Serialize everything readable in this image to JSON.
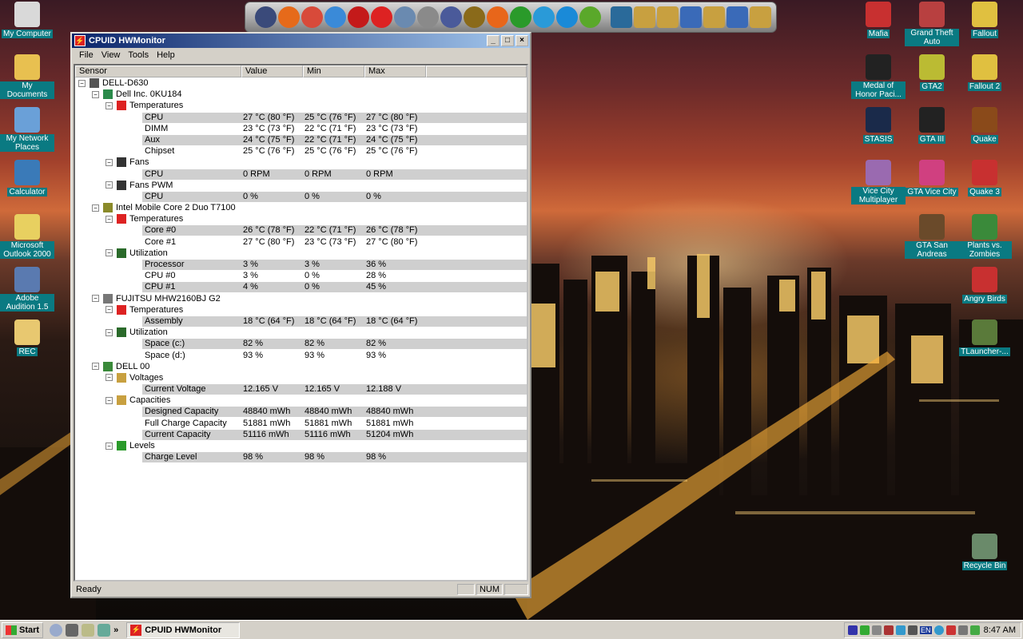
{
  "desktop": {
    "left_icons": [
      {
        "label": "My Computer",
        "icon": "my-computer-icon"
      },
      {
        "label": "My Documents",
        "icon": "my-documents-icon"
      },
      {
        "label": "My Network Places",
        "icon": "network-places-icon"
      },
      {
        "label": "Calculator",
        "icon": "calculator-icon"
      },
      {
        "label": "Microsoft Outlook 2000",
        "icon": "outlook-icon"
      },
      {
        "label": "Adobe Audition 1.5",
        "icon": "adobe-audition-icon"
      },
      {
        "label": "REC",
        "icon": "folder-icon"
      }
    ],
    "right_icons": [
      {
        "label": "Mafia",
        "icon": "mafia-icon"
      },
      {
        "label": "Grand Theft Auto",
        "icon": "gta-icon"
      },
      {
        "label": "Fallout",
        "icon": "fallout-icon"
      },
      {
        "label": "Medal of Honor Paci...",
        "icon": "medal-of-honor-icon"
      },
      {
        "label": "GTA2",
        "icon": "gta2-icon"
      },
      {
        "label": "Fallout 2",
        "icon": "fallout2-icon"
      },
      {
        "label": "STASIS",
        "icon": "stasis-icon"
      },
      {
        "label": "GTA III",
        "icon": "gta3-icon"
      },
      {
        "label": "Quake",
        "icon": "quake-icon"
      },
      {
        "label": "Vice City Multiplayer",
        "icon": "vice-city-multiplayer-icon"
      },
      {
        "label": "GTA Vice City",
        "icon": "gta-vice-city-icon"
      },
      {
        "label": "Quake 3",
        "icon": "quake3-icon"
      },
      {
        "label": "GTA San Andreas",
        "icon": "gta-san-andreas-icon"
      },
      {
        "label": "Plants vs. Zombies",
        "icon": "plants-vs-zombies-icon"
      },
      {
        "label": "Angry Birds",
        "icon": "angry-birds-icon"
      },
      {
        "label": "TLauncher-...",
        "icon": "tlauncher-icon"
      },
      {
        "label": "Recycle Bin",
        "icon": "recycle-bin-icon"
      }
    ]
  },
  "dock": {
    "items": [
      "firefox-like-icon",
      "firefox-icon",
      "chrome-canary-icon",
      "chrome-icon",
      "opera-icon",
      "flash-icon",
      "folder-icon",
      "settings-icon",
      "xf-icon",
      "game-icon",
      "origin-icon",
      "icq-icon",
      "telegram-icon",
      "skype-icon",
      "utorrent-icon",
      "keyboard-icon",
      "folders-icon"
    ],
    "colors": [
      "#3a4a7a",
      "#e66a1a",
      "#d84a3a",
      "#3a8ad8",
      "#c41a1a",
      "#d22",
      "#6a8ab0",
      "#8a8a8a",
      "#4a5a9a",
      "#8a6a1a",
      "#e8661a",
      "#2a9a2a",
      "#2a9ad8",
      "#1a8ad8",
      "#5aa82a",
      "#2a6a9a",
      "#c8a040"
    ]
  },
  "window": {
    "title": "CPUID HWMonitor",
    "menu": [
      "File",
      "View",
      "Tools",
      "Help"
    ],
    "columns": [
      "Sensor",
      "Value",
      "Min",
      "Max"
    ],
    "status": "Ready",
    "status_num": "NUM"
  },
  "tree": [
    {
      "level": 0,
      "name": "DELL-D630",
      "kind": "computer",
      "exp": "-"
    },
    {
      "level": 1,
      "name": "Dell Inc. 0KU184",
      "kind": "board",
      "exp": "-"
    },
    {
      "level": 2,
      "name": "Temperatures",
      "kind": "temp",
      "exp": "-"
    },
    {
      "level": 3,
      "name": "CPU",
      "value": "27 °C (80 °F)",
      "min": "25 °C (76 °F)",
      "max": "27 °C (80 °F)"
    },
    {
      "level": 3,
      "name": "DIMM",
      "value": "23 °C (73 °F)",
      "min": "22 °C (71 °F)",
      "max": "23 °C (73 °F)"
    },
    {
      "level": 3,
      "name": "Aux",
      "value": "24 °C (75 °F)",
      "min": "22 °C (71 °F)",
      "max": "24 °C (75 °F)"
    },
    {
      "level": 3,
      "name": "Chipset",
      "value": "25 °C (76 °F)",
      "min": "25 °C (76 °F)",
      "max": "25 °C (76 °F)"
    },
    {
      "level": 2,
      "name": "Fans",
      "kind": "fan",
      "exp": "-"
    },
    {
      "level": 3,
      "name": "CPU",
      "value": "0 RPM",
      "min": "0 RPM",
      "max": "0 RPM"
    },
    {
      "level": 2,
      "name": "Fans PWM",
      "kind": "fan",
      "exp": "-"
    },
    {
      "level": 3,
      "name": "CPU",
      "value": "0 %",
      "min": "0 %",
      "max": "0 %"
    },
    {
      "level": 1,
      "name": "Intel Mobile Core 2 Duo T7100",
      "kind": "cpu",
      "exp": "-"
    },
    {
      "level": 2,
      "name": "Temperatures",
      "kind": "temp",
      "exp": "-"
    },
    {
      "level": 3,
      "name": "Core #0",
      "value": "26 °C (78 °F)",
      "min": "22 °C (71 °F)",
      "max": "26 °C (78 °F)"
    },
    {
      "level": 3,
      "name": "Core #1",
      "value": "27 °C (80 °F)",
      "min": "23 °C (73 °F)",
      "max": "27 °C (80 °F)"
    },
    {
      "level": 2,
      "name": "Utilization",
      "kind": "util",
      "exp": "-"
    },
    {
      "level": 3,
      "name": "Processor",
      "value": "3 %",
      "min": "3 %",
      "max": "36 %"
    },
    {
      "level": 3,
      "name": "CPU #0",
      "value": "3 %",
      "min": "0 %",
      "max": "28 %"
    },
    {
      "level": 3,
      "name": "CPU #1",
      "value": "4 %",
      "min": "0 %",
      "max": "45 %"
    },
    {
      "level": 1,
      "name": "FUJITSU MHW2160BJ G2",
      "kind": "disk",
      "exp": "-"
    },
    {
      "level": 2,
      "name": "Temperatures",
      "kind": "temp",
      "exp": "-"
    },
    {
      "level": 3,
      "name": "Assembly",
      "value": "18 °C (64 °F)",
      "min": "18 °C (64 °F)",
      "max": "18 °C (64 °F)"
    },
    {
      "level": 2,
      "name": "Utilization",
      "kind": "util",
      "exp": "-"
    },
    {
      "level": 3,
      "name": "Space (c:)",
      "value": "82 %",
      "min": "82 %",
      "max": "82 %"
    },
    {
      "level": 3,
      "name": "Space (d:)",
      "value": "93 %",
      "min": "93 %",
      "max": "93 %"
    },
    {
      "level": 1,
      "name": "DELL 00",
      "kind": "battery",
      "exp": "-"
    },
    {
      "level": 2,
      "name": "Voltages",
      "kind": "volt",
      "exp": "-"
    },
    {
      "level": 3,
      "name": "Current Voltage",
      "value": "12.165 V",
      "min": "12.165 V",
      "max": "12.188 V"
    },
    {
      "level": 2,
      "name": "Capacities",
      "kind": "volt",
      "exp": "-"
    },
    {
      "level": 3,
      "name": "Designed Capacity",
      "value": "48840 mWh",
      "min": "48840 mWh",
      "max": "48840 mWh"
    },
    {
      "level": 3,
      "name": "Full Charge Capacity",
      "value": "51881 mWh",
      "min": "51881 mWh",
      "max": "51881 mWh"
    },
    {
      "level": 3,
      "name": "Current Capacity",
      "value": "51116 mWh",
      "min": "51116 mWh",
      "max": "51204 mWh"
    },
    {
      "level": 2,
      "name": "Levels",
      "kind": "level",
      "exp": "-"
    },
    {
      "level": 3,
      "name": "Charge Level",
      "value": "98 %",
      "min": "98 %",
      "max": "98 %"
    }
  ],
  "taskbar": {
    "start": "Start",
    "task": "CPUID HWMonitor",
    "quicklaunch_more": "»",
    "tray_lang": "EN",
    "clock": "8:47 AM"
  }
}
